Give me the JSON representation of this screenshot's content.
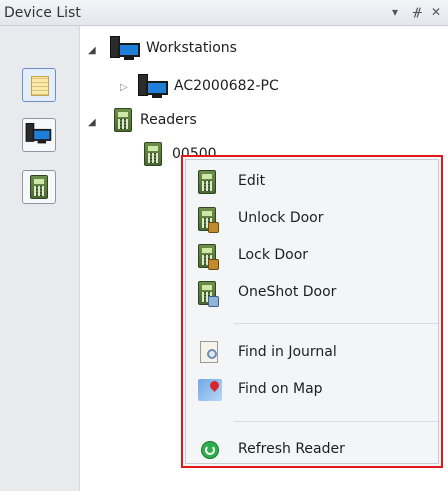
{
  "panel": {
    "title": "Device List",
    "controls": {
      "dropdown": "▾",
      "pin": "ᚌ",
      "close": "✕"
    }
  },
  "toolbar": {
    "buttons": [
      {
        "icon": "notes-icon",
        "active": true
      },
      {
        "icon": "workstation-icon",
        "active": false
      },
      {
        "icon": "reader-icon",
        "active": false
      }
    ]
  },
  "tree": {
    "workstations": {
      "label": "Workstations",
      "expanded": true,
      "children": [
        {
          "label": "AC2000682-PC",
          "expanded": false
        }
      ]
    },
    "readers": {
      "label": "Readers",
      "expanded": true,
      "children": [
        {
          "label": "00500"
        }
      ]
    }
  },
  "context_menu": {
    "items": [
      {
        "label": "Edit",
        "icon": "reader-edit-icon"
      },
      {
        "label": "Unlock Door",
        "icon": "reader-unlock-icon"
      },
      {
        "label": "Lock Door",
        "icon": "reader-lock-icon"
      },
      {
        "label": "OneShot Door",
        "icon": "reader-oneshot-icon"
      },
      {
        "label": "Find in Journal",
        "icon": "journal-search-icon"
      },
      {
        "label": "Find on Map",
        "icon": "map-pin-icon"
      },
      {
        "label": "Refresh Reader",
        "icon": "refresh-icon"
      }
    ],
    "highlight_color": "#e01818"
  }
}
